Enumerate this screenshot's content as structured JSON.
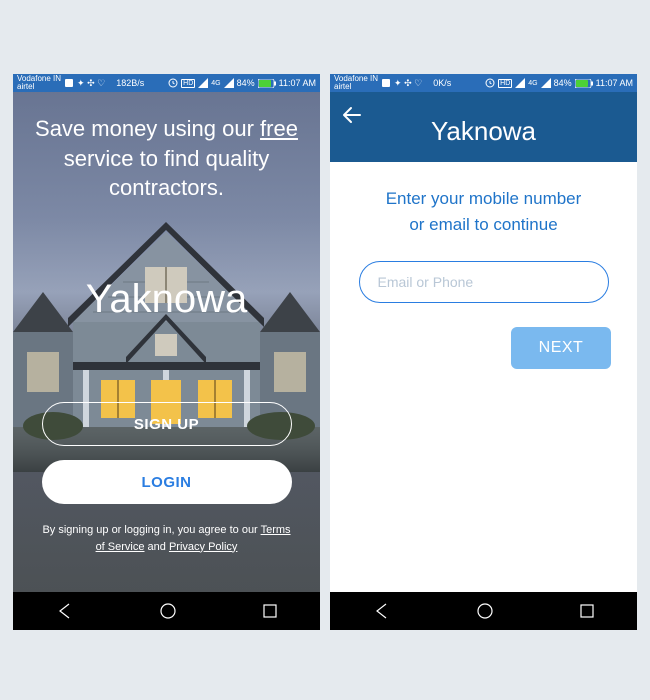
{
  "status": {
    "carrier": "Vodafone IN\nairtel",
    "speed_left": "182B/s",
    "speed_right": "0K/s",
    "battery": "84%",
    "time": "11:07 AM"
  },
  "left": {
    "headline_pre": "Save money using our ",
    "headline_free": "free",
    "headline_post": " service to find quality contractors.",
    "brand": "Yaknowa",
    "signup": "SIGN UP",
    "login": "LOGIN",
    "legal_pre": "By signing up or logging in, you agree to our ",
    "terms": "Terms of Service",
    "and": " and ",
    "privacy": "Privacy Policy"
  },
  "right": {
    "title": "Yaknowa",
    "prompt_line1": "Enter your mobile number",
    "prompt_line2": "or email to continue",
    "placeholder": "Email or Phone",
    "next": "NEXT"
  }
}
